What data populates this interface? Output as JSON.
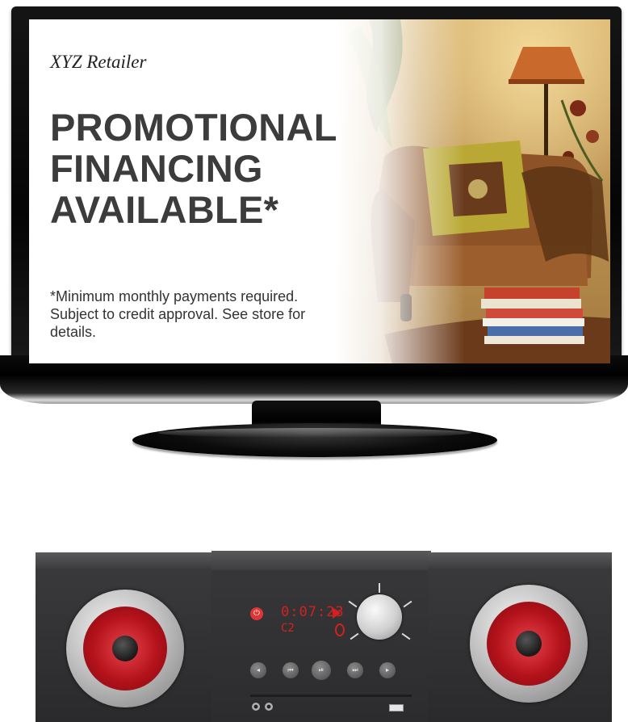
{
  "tv": {
    "retailer": "XYZ Retailer",
    "headline": [
      "PROMOTIONAL",
      "FINANCING",
      "AVAILABLE*"
    ],
    "disclaimer": "*Minimum monthly payments required. Subject to credit approval. See store for details."
  },
  "stereo": {
    "display_time": "0:07:23",
    "display_track": "C2",
    "buttons": [
      "power-icon",
      "previous-icon",
      "rewind-icon",
      "play-pause-icon",
      "forward-icon",
      "next-icon"
    ]
  },
  "colors": {
    "bezel": "#0a0a0a",
    "headline_text": "#3c3c3c",
    "woofer_red": "#b4121b",
    "display_red": "#d52020"
  }
}
